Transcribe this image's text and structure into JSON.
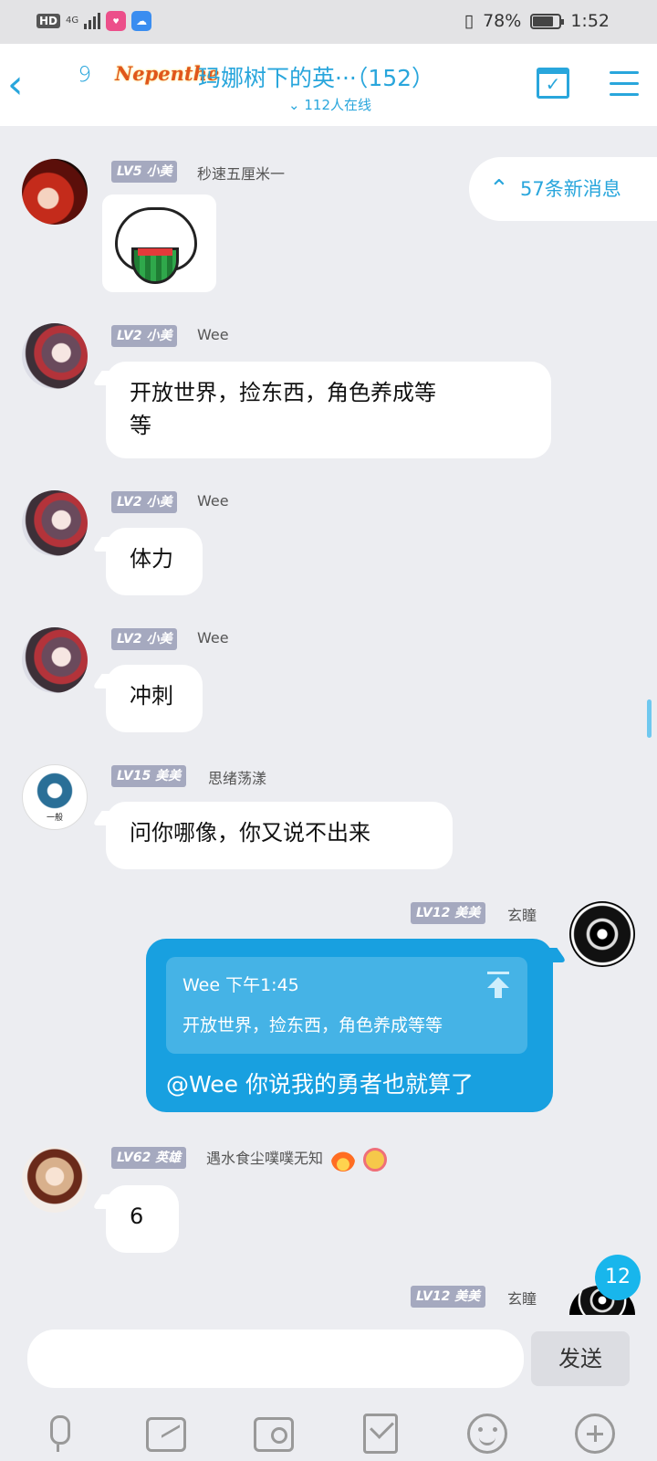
{
  "status_bar": {
    "hd": "HD",
    "network": "4G",
    "battery": "78%",
    "time": "1:52"
  },
  "header": {
    "group_badge": "Nepenthe",
    "title": "玛娜树下的英···（152）",
    "online": "112人在线"
  },
  "new_messages": {
    "label": "57条新消息"
  },
  "messages": [
    {
      "level": "LV5 小美",
      "name": "秒速五厘米一",
      "type": "sticker"
    },
    {
      "level": "LV2 小美",
      "name": "Wee",
      "text_line1": "开放世界，捡东西，角色养成等",
      "text_line2": "等"
    },
    {
      "level": "LV2 小美",
      "name": "Wee",
      "text": "体力"
    },
    {
      "level": "LV2 小美",
      "name": "Wee",
      "text": "冲刺"
    },
    {
      "level": "LV15 美美",
      "name": "思绪荡漾",
      "text": "问你哪像，你又说不出来"
    },
    {
      "level": "LV12 美美",
      "name": "玄瞳",
      "quote_header": "Wee 下午1:45",
      "quote_text": "开放世界，捡东西，角色养成等等",
      "text": "@Wee 你说我的勇者也就算了"
    },
    {
      "level": "LV62 英雄",
      "name": "遇水食尘噗噗无知",
      "text": "6"
    },
    {
      "level": "LV12 美美",
      "name": "玄瞳"
    }
  ],
  "bear_avatar_caption": "一般",
  "unread_badge": "12",
  "input": {
    "placeholder": "",
    "send_label": "发送"
  },
  "colors": {
    "accent": "#29a6dc",
    "sent_bubble": "#18a0e0",
    "level_badge": "#a5a9bf",
    "background": "#ecedf1"
  }
}
